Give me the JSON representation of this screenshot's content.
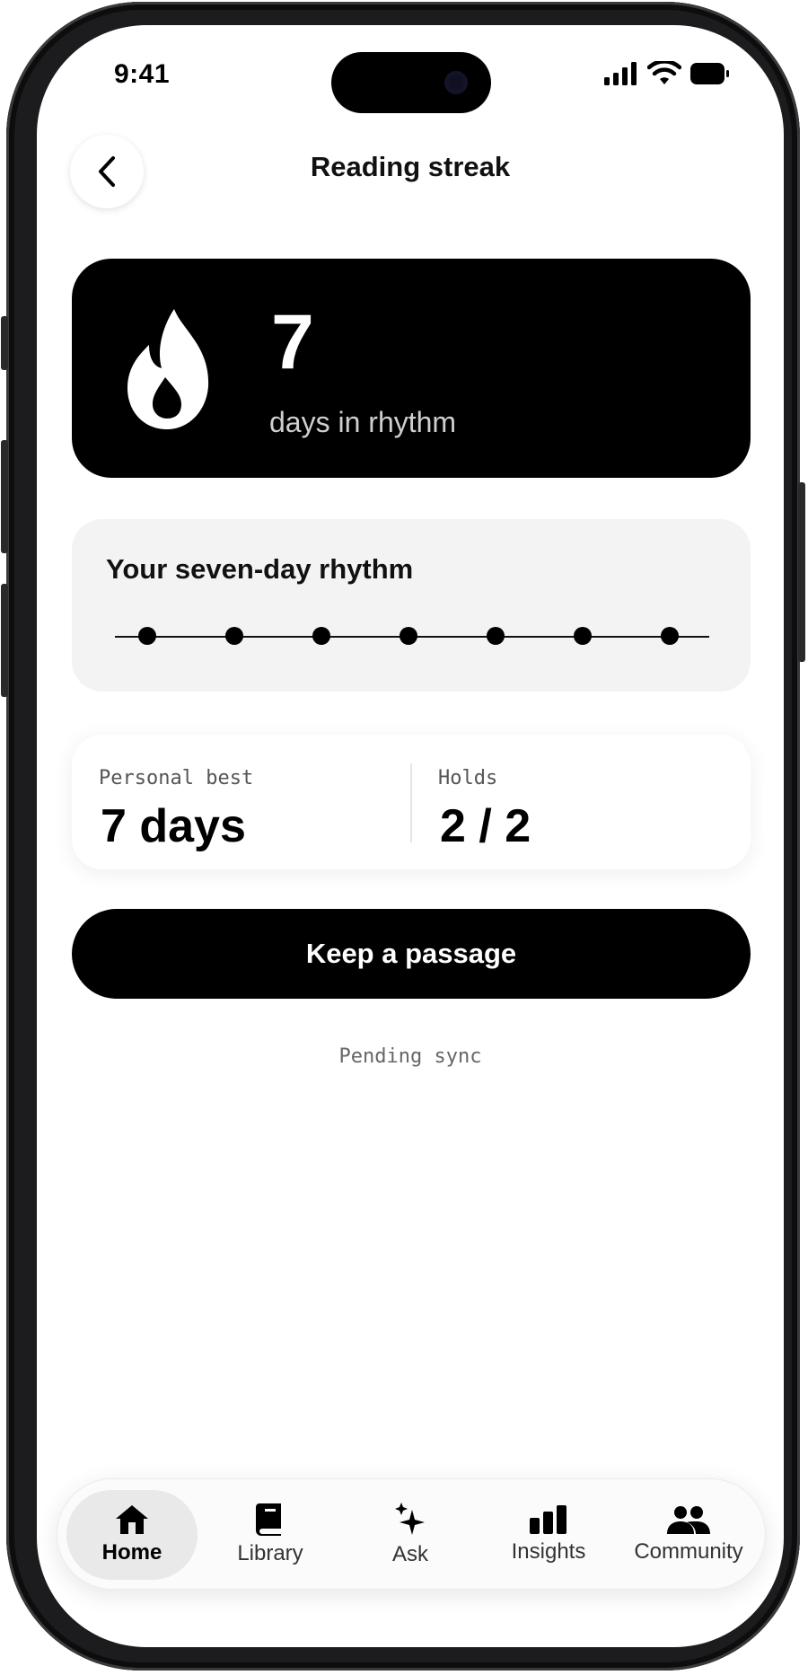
{
  "status_bar": {
    "time": "9:41"
  },
  "header": {
    "title": "Reading streak"
  },
  "streak": {
    "count": "7",
    "caption": "days in rhythm"
  },
  "rhythm": {
    "title": "Your seven-day rhythm",
    "days_completed": 7,
    "days_total": 7
  },
  "stats": {
    "personal_best": {
      "label": "Personal best",
      "value": "7 days"
    },
    "holds": {
      "label": "Holds",
      "value": "2 / 2"
    }
  },
  "cta": {
    "label": "Keep a passage"
  },
  "sync_status": "Pending sync",
  "tabs": [
    {
      "label": "Home",
      "icon": "home-icon",
      "active": true
    },
    {
      "label": "Library",
      "icon": "book-icon",
      "active": false
    },
    {
      "label": "Ask",
      "icon": "sparkle-icon",
      "active": false
    },
    {
      "label": "Insights",
      "icon": "bar-chart-icon",
      "active": false
    },
    {
      "label": "Community",
      "icon": "people-icon",
      "active": false
    }
  ]
}
